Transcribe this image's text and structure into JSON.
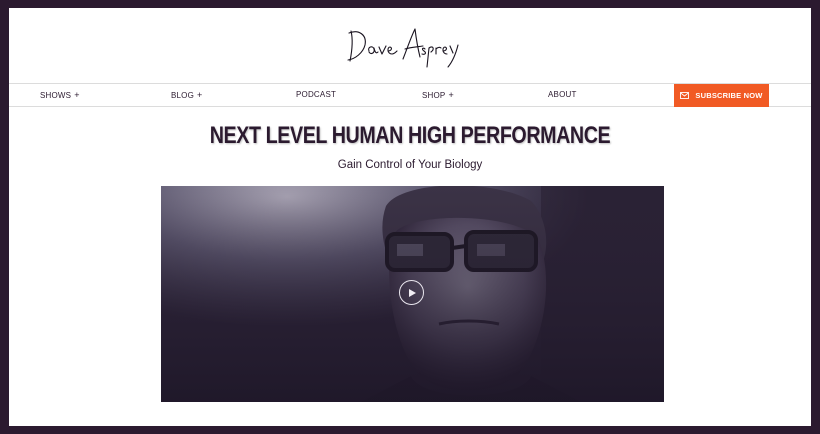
{
  "header": {
    "logo_text": "Dave Asprey"
  },
  "nav": {
    "items": [
      {
        "label": "SHOWS",
        "has_submenu": true
      },
      {
        "label": "BLOG",
        "has_submenu": true
      },
      {
        "label": "PODCAST",
        "has_submenu": false
      },
      {
        "label": "SHOP",
        "has_submenu": true
      },
      {
        "label": "ABOUT",
        "has_submenu": false
      }
    ],
    "submenu_symbol": "+",
    "subscribe_label": "SUBSCRIBE NOW",
    "subscribe_icon": "envelope-icon"
  },
  "hero": {
    "headline": "NEXT LEVEL HUMAN HIGH PERFORMANCE",
    "subheadline": "Gain Control of Your Biology"
  },
  "video": {
    "play_icon": "play-icon"
  },
  "colors": {
    "frame": "#2b1a2f",
    "accent": "#f15a24",
    "text": "#2b1a2f"
  }
}
